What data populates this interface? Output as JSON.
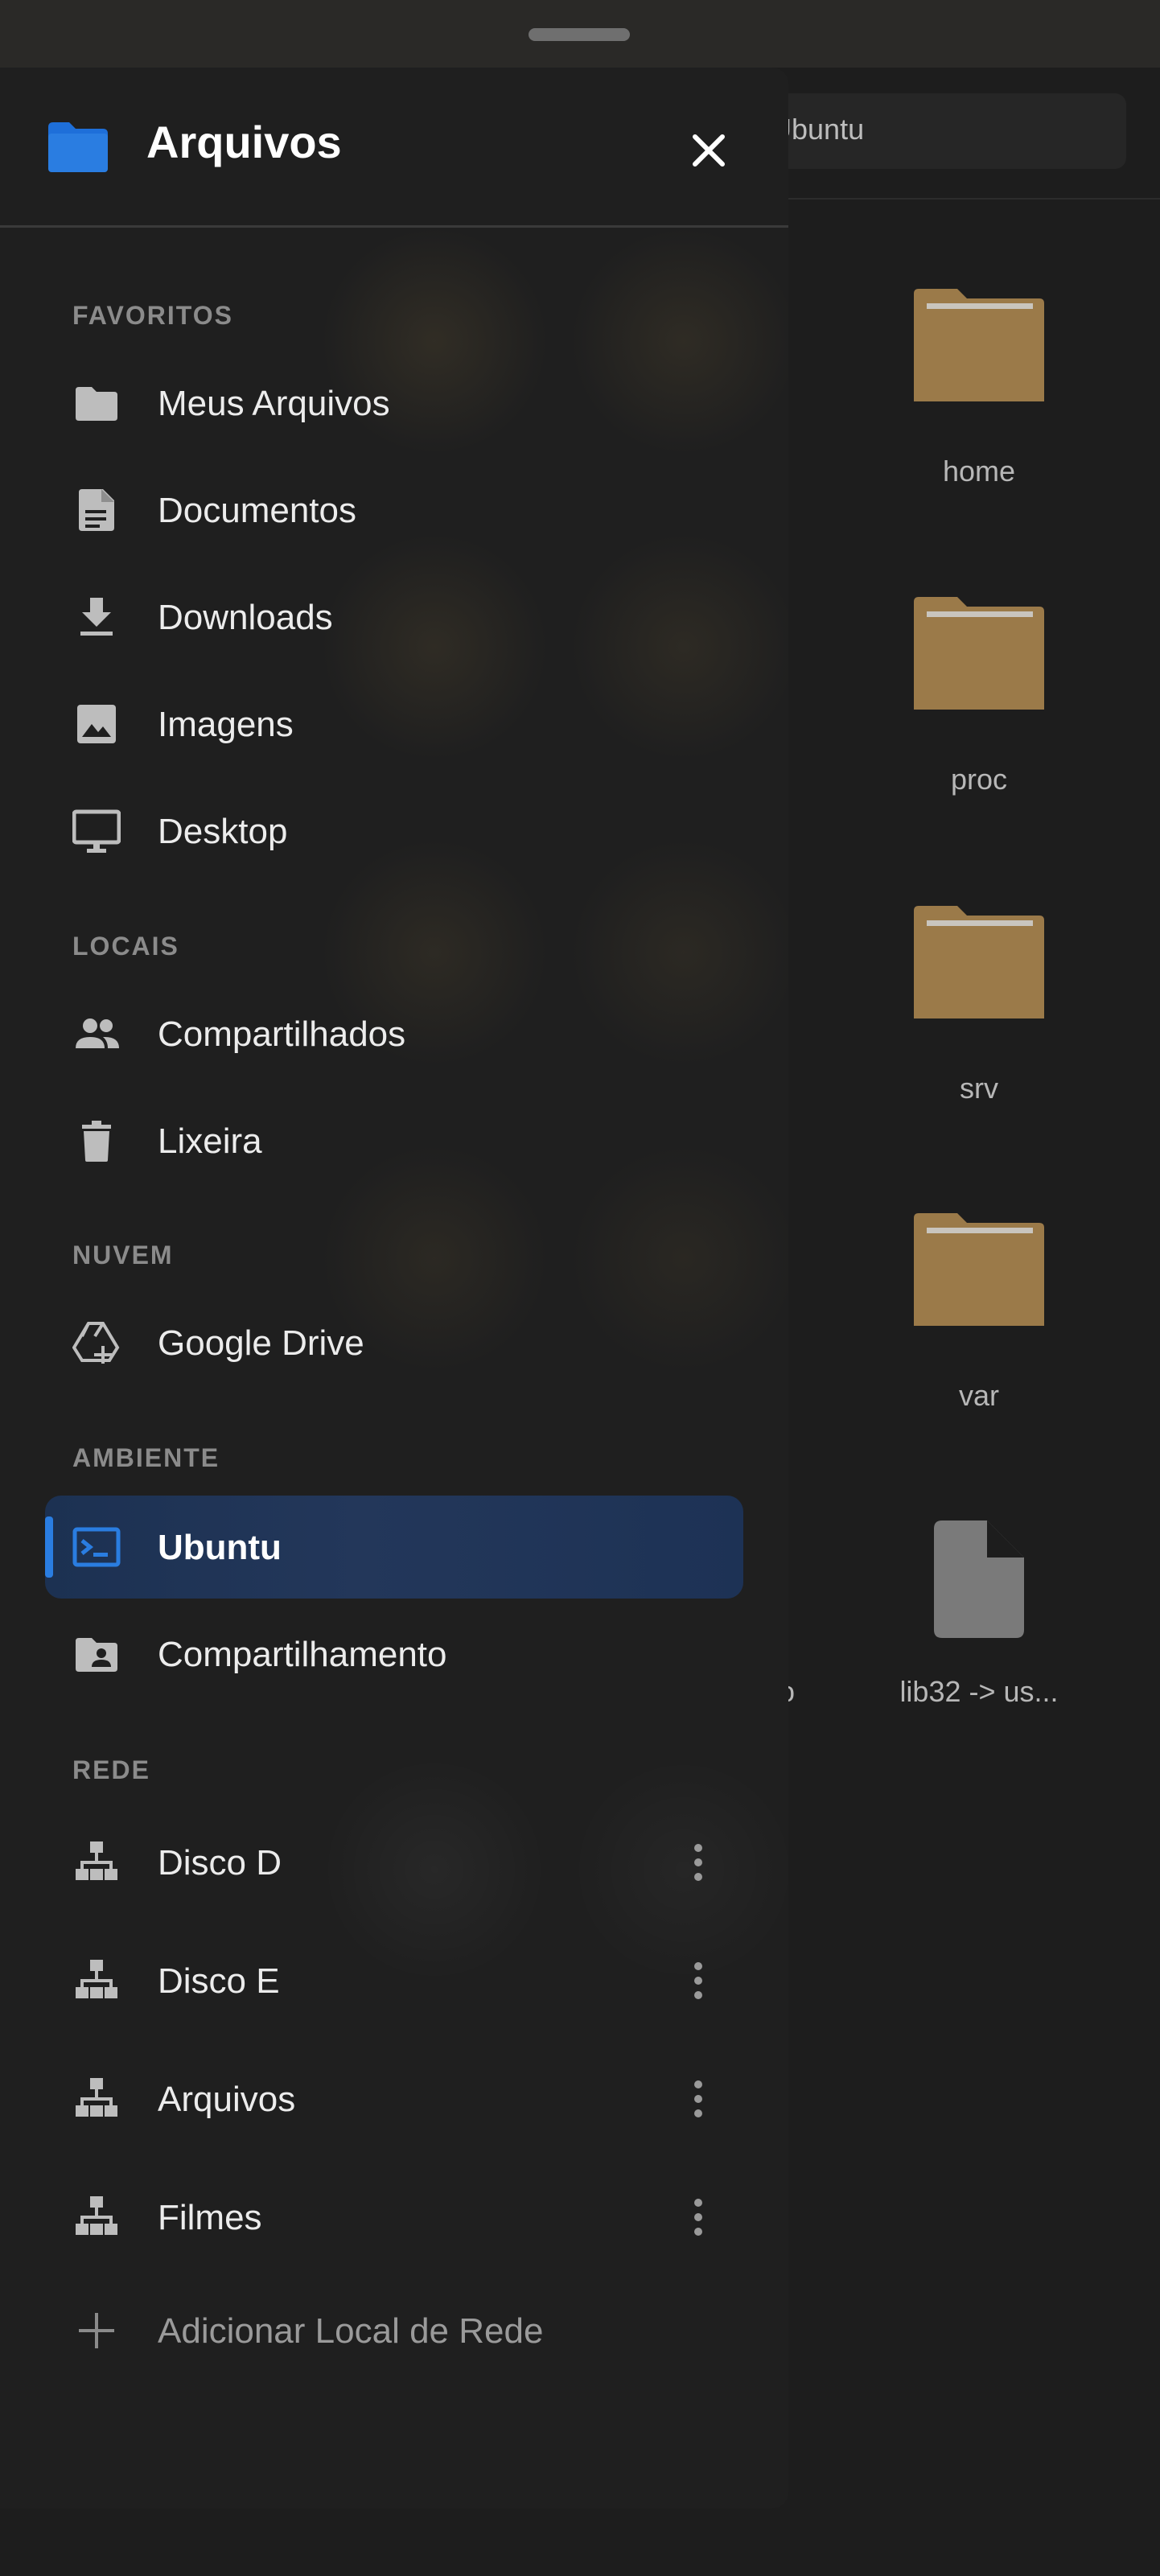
{
  "background": {
    "search_text": "Ubuntu",
    "items": [
      {
        "name": "home",
        "type": "folder"
      },
      {
        "name": "proc",
        "type": "folder"
      },
      {
        "name": "srv",
        "type": "folder"
      },
      {
        "name": "var",
        "type": "folder"
      },
      {
        "name": "lib32 -> us...",
        "type": "file"
      }
    ],
    "partial_left_label": "o"
  },
  "drawer": {
    "title": "Arquivos",
    "sections": {
      "favorites": "FAVORITOS",
      "local": "LOCAIS",
      "cloud": "NUVEM",
      "environment": "AMBIENTE",
      "network": "REDE"
    },
    "favorites": [
      {
        "label": "Meus Arquivos",
        "icon": "folder-icon"
      },
      {
        "label": "Documentos",
        "icon": "document-icon"
      },
      {
        "label": "Downloads",
        "icon": "download-icon"
      },
      {
        "label": "Imagens",
        "icon": "image-icon"
      },
      {
        "label": "Desktop",
        "icon": "monitor-icon"
      }
    ],
    "local": [
      {
        "label": "Compartilhados",
        "icon": "people-icon"
      },
      {
        "label": "Lixeira",
        "icon": "trash-icon"
      }
    ],
    "cloud": [
      {
        "label": "Google Drive",
        "icon": "drive-add-icon"
      }
    ],
    "environment": [
      {
        "label": "Ubuntu",
        "icon": "terminal-icon",
        "active": true
      },
      {
        "label": "Compartilhamento",
        "icon": "shared-folder-icon"
      }
    ],
    "network": [
      {
        "label": "Disco D",
        "icon": "network-icon"
      },
      {
        "label": "Disco E",
        "icon": "network-icon"
      },
      {
        "label": "Arquivos",
        "icon": "network-icon"
      },
      {
        "label": "Filmes",
        "icon": "network-icon"
      }
    ],
    "add_network": "Adicionar Local de Rede"
  },
  "colors": {
    "accent": "#2a7de1",
    "active_bg": "#1f3558",
    "folder": "#9b7a49",
    "drawer_bg": "#1f1f1f"
  }
}
